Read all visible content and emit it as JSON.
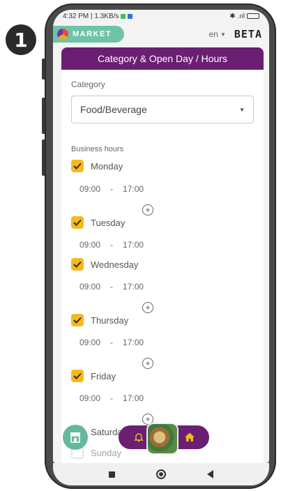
{
  "step": "1",
  "status": {
    "time_net": "4:32 PM | 1.3KB/s",
    "right_icons": "✱ .ııl"
  },
  "topbar": {
    "brand": "MARKET",
    "lang": "en",
    "beta": "BETA"
  },
  "card": {
    "title": "Category & Open Day / Hours",
    "category_label": "Category",
    "category_value": "Food/Beverage",
    "hours_label": "Business hours"
  },
  "days": [
    {
      "name": "Monday",
      "checked": true,
      "open": "09:00",
      "sep": "-",
      "close": "17:00"
    },
    {
      "name": "Tuesday",
      "checked": true,
      "open": "09:00",
      "sep": "-",
      "close": "17:00"
    },
    {
      "name": "Wednesday",
      "checked": true,
      "open": "09:00",
      "sep": "-",
      "close": "17:00"
    },
    {
      "name": "Thursday",
      "checked": true,
      "open": "09:00",
      "sep": "-",
      "close": "17:00"
    },
    {
      "name": "Friday",
      "checked": true,
      "open": "09:00",
      "sep": "-",
      "close": "17:00"
    },
    {
      "name": "Saturday",
      "checked": false
    },
    {
      "name": "Sunday",
      "checked": false
    }
  ],
  "colors": {
    "header": "#6a1f73",
    "checkbox": "#f5b91c",
    "brand": "#6fc3a6"
  },
  "icons": {
    "add": "plus-circle-icon",
    "bell": "bell-icon",
    "home": "home-icon",
    "store": "store-icon"
  }
}
